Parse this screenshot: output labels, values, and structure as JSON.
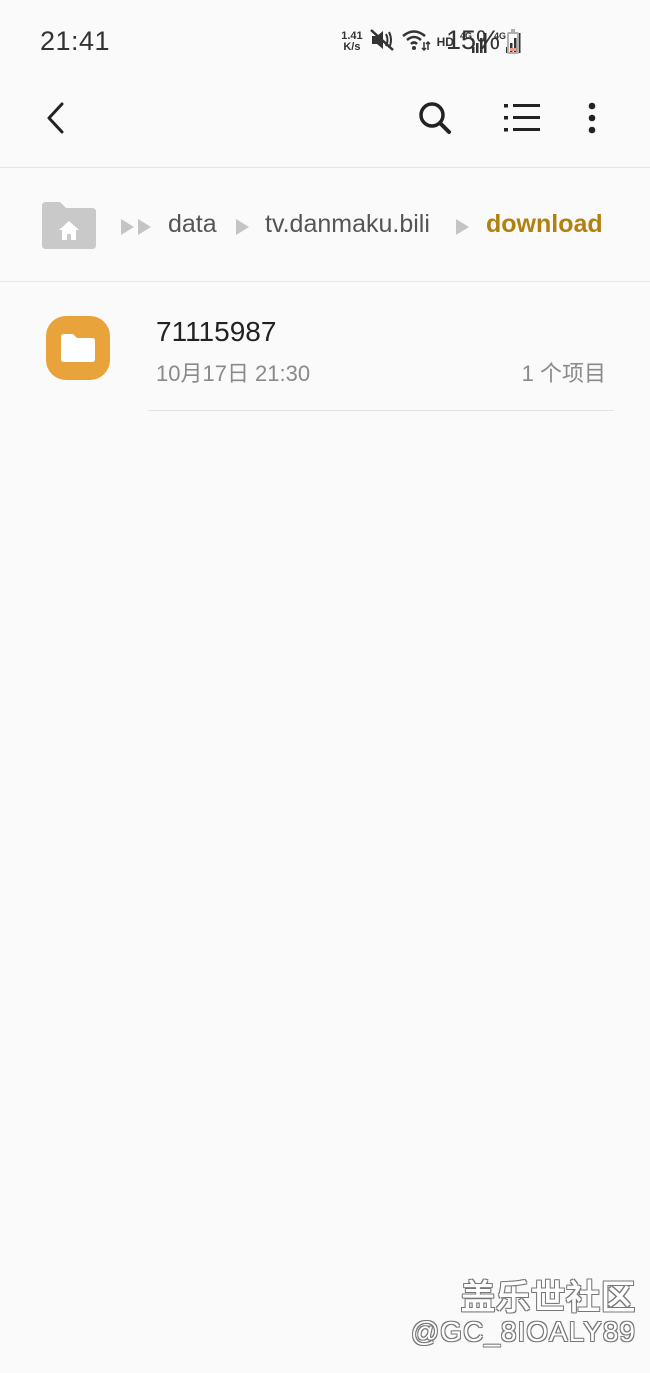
{
  "status_bar": {
    "time": "21:41",
    "net_speed_value": "1.41",
    "net_speed_unit": "K/s",
    "hd_label": "HD",
    "network_type_1": "4G",
    "network_type_2": "4G",
    "battery_percent": "15%",
    "battery_level": 0.15,
    "icons": [
      "mute-icon",
      "wifi-icon",
      "signal-icon",
      "signal-icon",
      "battery-icon"
    ]
  },
  "toolbar": {
    "icons": [
      "back-icon",
      "search-icon",
      "list-view-icon",
      "more-vertical-icon"
    ]
  },
  "breadcrumb": {
    "home_icon": "home-folder-icon",
    "items": [
      {
        "label": "data"
      },
      {
        "label": "tv.danmaku.bili"
      },
      {
        "label": "download"
      }
    ],
    "active_color": "#b1800e"
  },
  "files": [
    {
      "name": "71115987",
      "date": "10月17日 21:30",
      "count": "1 个项目",
      "icon": "folder-icon",
      "icon_color": "#e9a33b"
    }
  ],
  "watermark": {
    "title": "盖乐世社区",
    "user": "@GC_8IOALY89"
  }
}
